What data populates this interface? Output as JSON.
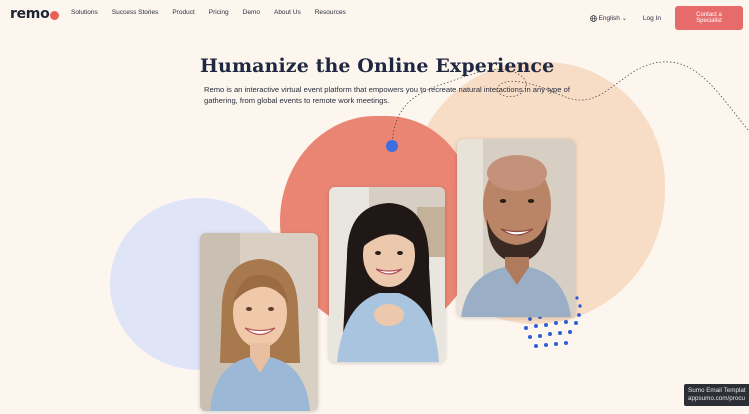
{
  "nav": {
    "logo_text": "remo",
    "links": [
      "Solutions",
      "Success Stories",
      "Product",
      "Pricing",
      "Demo",
      "About Us",
      "Resources"
    ],
    "language": "English",
    "login": "Log In",
    "cta": "Contact a Specialist"
  },
  "hero": {
    "headline": "Humanize the Online Experience",
    "subtext": "Remo is an interactive virtual event platform that empowers you to recreate natural interactions in any type of gathering, from global events to remote work meetings."
  },
  "tooltip": {
    "line1": "Sumo Email Templat",
    "line2": "appsumo.com/procu"
  },
  "colors": {
    "background": "#fdf6ef",
    "cta": "#e86b6b",
    "coral_blob": "#ea8574",
    "peach_blob": "#f7dcc6",
    "blue_blob": "#dfe4f7",
    "accent_dot": "#3d6ee0"
  }
}
